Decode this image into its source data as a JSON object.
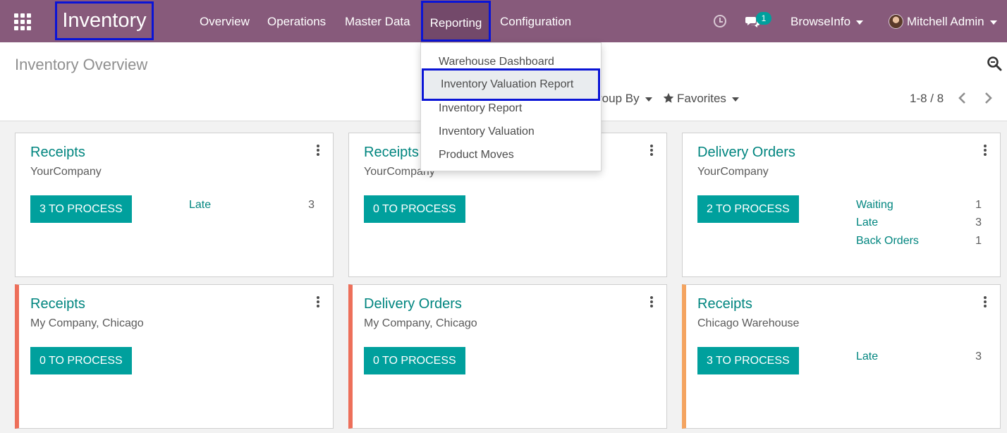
{
  "navbar": {
    "app_title": "Inventory",
    "menu": {
      "overview": "Overview",
      "operations": "Operations",
      "master_data": "Master Data",
      "reporting": "Reporting",
      "configuration": "Configuration"
    },
    "messages_badge": "1",
    "company": "BrowseInfo",
    "user": "Mitchell Admin",
    "brand_color": "#875a7b",
    "highlight_color": "#0a14d6"
  },
  "control_panel": {
    "title": "Inventory Overview",
    "group_by": "roup By",
    "favorites": "Favorites",
    "pager": "1-8 / 8"
  },
  "reporting_menu": {
    "items": [
      "Warehouse Dashboard",
      "Inventory Valuation Report",
      "Inventory Report",
      "Inventory Valuation",
      "Product Moves"
    ],
    "active_index": 1
  },
  "cards": [
    {
      "title": "Receipts",
      "company": "YourCompany",
      "button": "3 TO PROCESS",
      "stats": [
        {
          "label": "Late",
          "count": "3"
        }
      ]
    },
    {
      "title": "Receipts",
      "company": "YourCompany",
      "button": "0 TO PROCESS",
      "stats": []
    },
    {
      "title": "Delivery Orders",
      "company": "YourCompany",
      "button": "2 TO PROCESS",
      "stats": [
        {
          "label": "Waiting",
          "count": "1"
        },
        {
          "label": "Late",
          "count": "3"
        },
        {
          "label": "Back Orders",
          "count": "1"
        }
      ]
    },
    {
      "title": "Receipts",
      "company": "My Company, Chicago",
      "button": "0 TO PROCESS",
      "stats": [],
      "stripe": "#ed6f5a"
    },
    {
      "title": "Delivery Orders",
      "company": "My Company, Chicago",
      "button": "0 TO PROCESS",
      "stats": [],
      "stripe": "#ed6f5a"
    },
    {
      "title": "Receipts",
      "company": "Chicago Warehouse",
      "button": "3 TO PROCESS",
      "stats": [
        {
          "label": "Late",
          "count": "3"
        }
      ],
      "stripe": "#f4a460"
    }
  ],
  "colors": {
    "accent": "#00a09d",
    "link": "#00857f"
  }
}
